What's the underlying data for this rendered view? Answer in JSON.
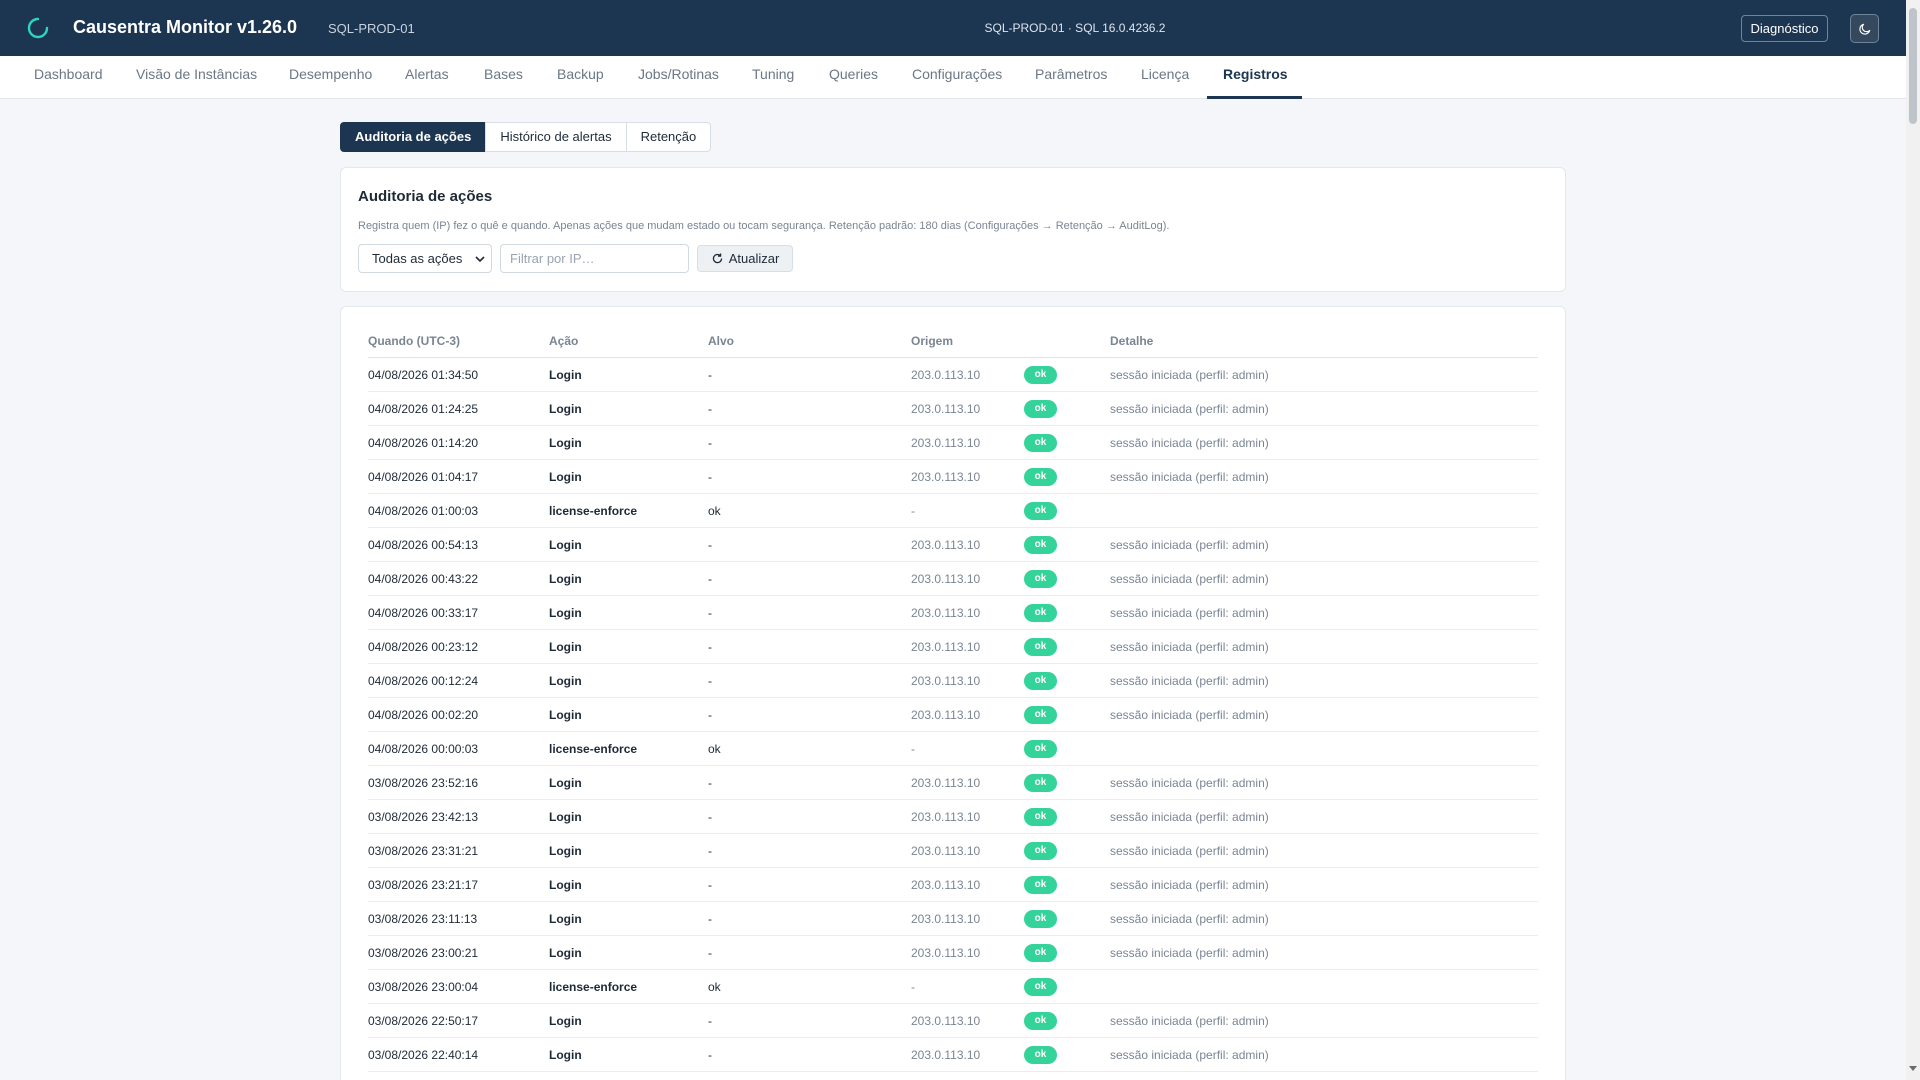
{
  "header": {
    "title": "Causentra Monitor v1.26.0",
    "instance": "SQL-PROD-01",
    "center_info": "SQL-PROD-01 · SQL 16.0.4236.2",
    "diagnostics_label": "Diagnóstico",
    "logo_icon": "loading-ring-icon",
    "theme_icon": "moon-icon"
  },
  "nav": {
    "tabs": [
      {
        "label": "Dashboard"
      },
      {
        "label": "Visão de Instâncias"
      },
      {
        "label": "Desempenho"
      },
      {
        "label": "Alertas"
      },
      {
        "label": "Bases"
      },
      {
        "label": "Backup"
      },
      {
        "label": "Jobs/Rotinas"
      },
      {
        "label": "Tuning"
      },
      {
        "label": "Queries"
      },
      {
        "label": "Configurações"
      },
      {
        "label": "Parâmetros"
      },
      {
        "label": "Licença"
      },
      {
        "label": "Registros"
      }
    ],
    "active": "Registros"
  },
  "subtabs": [
    {
      "label": "Auditoria de ações"
    },
    {
      "label": "Histórico de alertas"
    },
    {
      "label": "Retenção"
    }
  ],
  "filter_card": {
    "title": "Auditoria de ações",
    "description": "Registra quem (IP) fez o quê e quando. Apenas ações que mudam estado ou tocam segurança. Retenção padrão: 180 dias (Configurações → Retenção → AuditLog).",
    "select_value": "Todas as ações",
    "ip_placeholder": "Filtrar por IP…",
    "refresh_label": "Atualizar"
  },
  "table": {
    "columns": [
      "Quando (UTC-3)",
      "Ação",
      "Alvo",
      "Origem",
      "Detalhe"
    ],
    "rows": [
      {
        "when": "04/08/2026 01:34:50",
        "action": "Login",
        "target": "-",
        "origin": "203.0.113.10",
        "status": "ok",
        "detail": "sessão iniciada (perfil: admin)"
      },
      {
        "when": "04/08/2026 01:24:25",
        "action": "Login",
        "target": "-",
        "origin": "203.0.113.10",
        "status": "ok",
        "detail": "sessão iniciada (perfil: admin)"
      },
      {
        "when": "04/08/2026 01:14:20",
        "action": "Login",
        "target": "-",
        "origin": "203.0.113.10",
        "status": "ok",
        "detail": "sessão iniciada (perfil: admin)"
      },
      {
        "when": "04/08/2026 01:04:17",
        "action": "Login",
        "target": "-",
        "origin": "203.0.113.10",
        "status": "ok",
        "detail": "sessão iniciada (perfil: admin)"
      },
      {
        "when": "04/08/2026 01:00:03",
        "action": "license-enforce",
        "target": "ok",
        "origin": "-",
        "status": "ok",
        "detail": ""
      },
      {
        "when": "04/08/2026 00:54:13",
        "action": "Login",
        "target": "-",
        "origin": "203.0.113.10",
        "status": "ok",
        "detail": "sessão iniciada (perfil: admin)"
      },
      {
        "when": "04/08/2026 00:43:22",
        "action": "Login",
        "target": "-",
        "origin": "203.0.113.10",
        "status": "ok",
        "detail": "sessão iniciada (perfil: admin)"
      },
      {
        "when": "04/08/2026 00:33:17",
        "action": "Login",
        "target": "-",
        "origin": "203.0.113.10",
        "status": "ok",
        "detail": "sessão iniciada (perfil: admin)"
      },
      {
        "when": "04/08/2026 00:23:12",
        "action": "Login",
        "target": "-",
        "origin": "203.0.113.10",
        "status": "ok",
        "detail": "sessão iniciada (perfil: admin)"
      },
      {
        "when": "04/08/2026 00:12:24",
        "action": "Login",
        "target": "-",
        "origin": "203.0.113.10",
        "status": "ok",
        "detail": "sessão iniciada (perfil: admin)"
      },
      {
        "when": "04/08/2026 00:02:20",
        "action": "Login",
        "target": "-",
        "origin": "203.0.113.10",
        "status": "ok",
        "detail": "sessão iniciada (perfil: admin)"
      },
      {
        "when": "04/08/2026 00:00:03",
        "action": "license-enforce",
        "target": "ok",
        "origin": "-",
        "status": "ok",
        "detail": ""
      },
      {
        "when": "03/08/2026 23:52:16",
        "action": "Login",
        "target": "-",
        "origin": "203.0.113.10",
        "status": "ok",
        "detail": "sessão iniciada (perfil: admin)"
      },
      {
        "when": "03/08/2026 23:42:13",
        "action": "Login",
        "target": "-",
        "origin": "203.0.113.10",
        "status": "ok",
        "detail": "sessão iniciada (perfil: admin)"
      },
      {
        "when": "03/08/2026 23:31:21",
        "action": "Login",
        "target": "-",
        "origin": "203.0.113.10",
        "status": "ok",
        "detail": "sessão iniciada (perfil: admin)"
      },
      {
        "when": "03/08/2026 23:21:17",
        "action": "Login",
        "target": "-",
        "origin": "203.0.113.10",
        "status": "ok",
        "detail": "sessão iniciada (perfil: admin)"
      },
      {
        "when": "03/08/2026 23:11:13",
        "action": "Login",
        "target": "-",
        "origin": "203.0.113.10",
        "status": "ok",
        "detail": "sessão iniciada (perfil: admin)"
      },
      {
        "when": "03/08/2026 23:00:21",
        "action": "Login",
        "target": "-",
        "origin": "203.0.113.10",
        "status": "ok",
        "detail": "sessão iniciada (perfil: admin)"
      },
      {
        "when": "03/08/2026 23:00:04",
        "action": "license-enforce",
        "target": "ok",
        "origin": "-",
        "status": "ok",
        "detail": ""
      },
      {
        "when": "03/08/2026 22:50:17",
        "action": "Login",
        "target": "-",
        "origin": "203.0.113.10",
        "status": "ok",
        "detail": "sessão iniciada (perfil: admin)"
      },
      {
        "when": "03/08/2026 22:40:14",
        "action": "Login",
        "target": "-",
        "origin": "203.0.113.10",
        "status": "ok",
        "detail": "sessão iniciada (perfil: admin)"
      }
    ]
  },
  "colors": {
    "header_bg": "#1c3550",
    "accent_teal": "#2dd4bf",
    "badge_ok": "#34d399"
  }
}
